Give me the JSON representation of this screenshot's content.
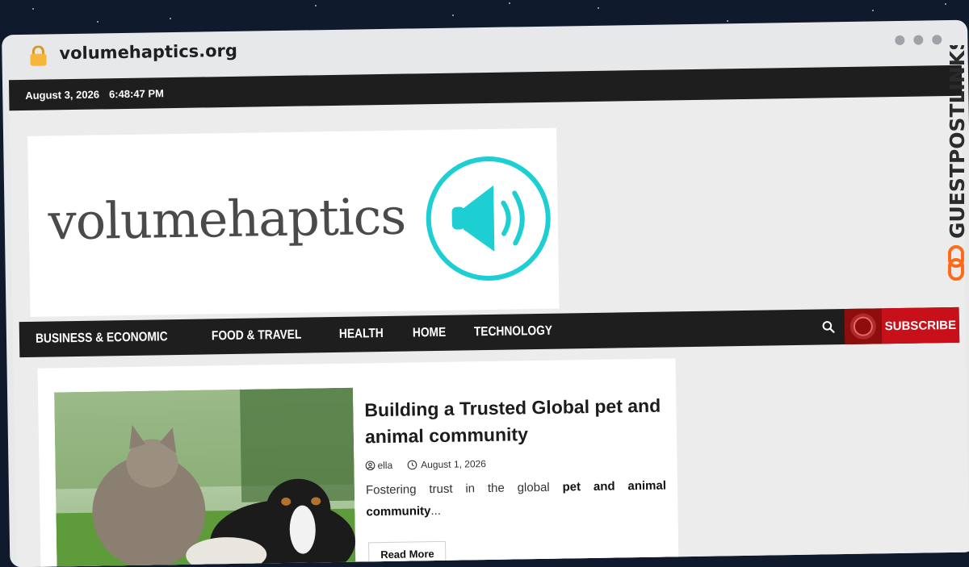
{
  "browser": {
    "url": "volumehaptics.org",
    "lock_icon": "lock-icon"
  },
  "topbar": {
    "date": "August 3, 2026",
    "time": "6:48:47 PM"
  },
  "logo": {
    "text": "volumehaptics",
    "icon": "speaker-icon",
    "accent": "#1dcfd3"
  },
  "nav": {
    "items": [
      {
        "label": "BUSINESS & ECONOMIC"
      },
      {
        "label": "FOOD & TRAVEL"
      },
      {
        "label": "HEALTH"
      },
      {
        "label": "HOME"
      },
      {
        "label": "TECHNOLOGY"
      }
    ],
    "subscribe": "SUBSCRIBE",
    "search_icon": "search-icon"
  },
  "post": {
    "title": "Building a Trusted Global pet and animal community",
    "author": "ella",
    "date": "August 1, 2026",
    "excerpt_plain": "Fostering trust in the global",
    "excerpt_bold": "pet and animal community",
    "excerpt_ellipsis": "...",
    "read_more": "Read More"
  },
  "watermark": {
    "text": "GUESTPOSTLINKS",
    "color": "#2b2b2b",
    "accent": "#ff6a1a"
  },
  "colors": {
    "topbar_bg": "#1e1e1e",
    "brand_red": "#c8101a",
    "live_red": "#8e0d0d"
  }
}
